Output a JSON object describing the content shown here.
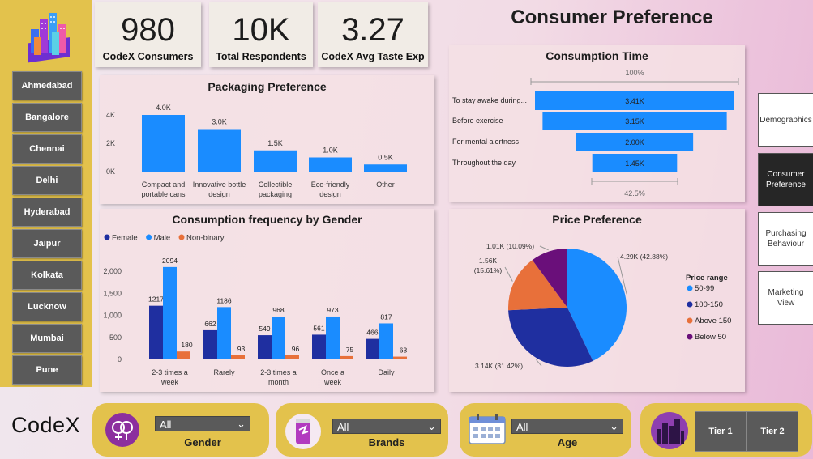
{
  "title": "Consumer Preference",
  "cities": [
    "Ahmedabad",
    "Bangalore",
    "Chennai",
    "Delhi",
    "Hyderabad",
    "Jaipur",
    "Kolkata",
    "Lucknow",
    "Mumbai",
    "Pune"
  ],
  "kpis": [
    {
      "value": "980",
      "label": "CodeX Consumers"
    },
    {
      "value": "10K",
      "label": "Total Respondents"
    },
    {
      "value": "3.27",
      "label": "CodeX Avg Taste Exp"
    }
  ],
  "nav": [
    "Demographics",
    "Consumer Preference",
    "Purchasing Behaviour",
    "Marketing View"
  ],
  "brand": "CodeX",
  "slicers": {
    "gender": {
      "value": "All",
      "label": "Gender"
    },
    "brands": {
      "value": "All",
      "label": "Brands"
    },
    "age": {
      "value": "All",
      "label": "Age"
    }
  },
  "tiers": [
    "Tier 1",
    "Tier 2"
  ],
  "colors": {
    "blue": "#1a8cff",
    "navy": "#1f2fa0",
    "orange": "#e8703a",
    "purple": "#6a0f7a",
    "yellow": "#e3c24c"
  },
  "chart_data": [
    {
      "type": "bar",
      "title": "Packaging Preference",
      "categories": [
        "Compact and portable cans",
        "Innovative bottle design",
        "Collectible packaging",
        "Eco-friendly design",
        "Other"
      ],
      "values": [
        4000,
        3000,
        1500,
        1000,
        500
      ],
      "data_labels": [
        "4.0K",
        "3.0K",
        "1.5K",
        "1.0K",
        "0.5K"
      ],
      "yticks": [
        "0K",
        "2K",
        "4K"
      ],
      "ylim": [
        0,
        4200
      ],
      "grid": false
    },
    {
      "type": "bar",
      "title": "Consumption Time",
      "orientation": "funnel",
      "categories": [
        "To stay awake during...",
        "Before exercise",
        "For mental alertness",
        "Throughout the day"
      ],
      "values": [
        3410,
        3150,
        2000,
        1450
      ],
      "data_labels": [
        "3.41K",
        "3.15K",
        "2.00K",
        "1.45K"
      ],
      "top_percent": "100%",
      "bottom_percent": "42.5%"
    },
    {
      "type": "bar",
      "title": "Consumption frequency by Gender",
      "categories": [
        "2-3 times a week",
        "Rarely",
        "2-3 times a month",
        "Once a week",
        "Daily"
      ],
      "series": [
        {
          "name": "Female",
          "values": [
            1217,
            662,
            549,
            561,
            466
          ]
        },
        {
          "name": "Male",
          "values": [
            2094,
            1186,
            968,
            973,
            817
          ]
        },
        {
          "name": "Non-binary",
          "values": [
            180,
            93,
            96,
            75,
            63
          ]
        }
      ],
      "yticks": [
        "0",
        "500",
        "1,000",
        "1,500",
        "2,000"
      ],
      "ylim": [
        0,
        2200
      ],
      "legend": "top-left"
    },
    {
      "type": "pie",
      "title": "Price Preference",
      "legend_title": "Price range",
      "slices": [
        {
          "name": "50-99",
          "value": 4290,
          "label": "4.29K (42.88%)"
        },
        {
          "name": "100-150",
          "value": 3140,
          "label": "3.14K (31.42%)"
        },
        {
          "name": "Above 150",
          "value": 1560,
          "label": "1.56K (15.61%)"
        },
        {
          "name": "Below 50",
          "value": 1010,
          "label": "1.01K (10.09%)"
        }
      ],
      "legend": "right"
    }
  ]
}
